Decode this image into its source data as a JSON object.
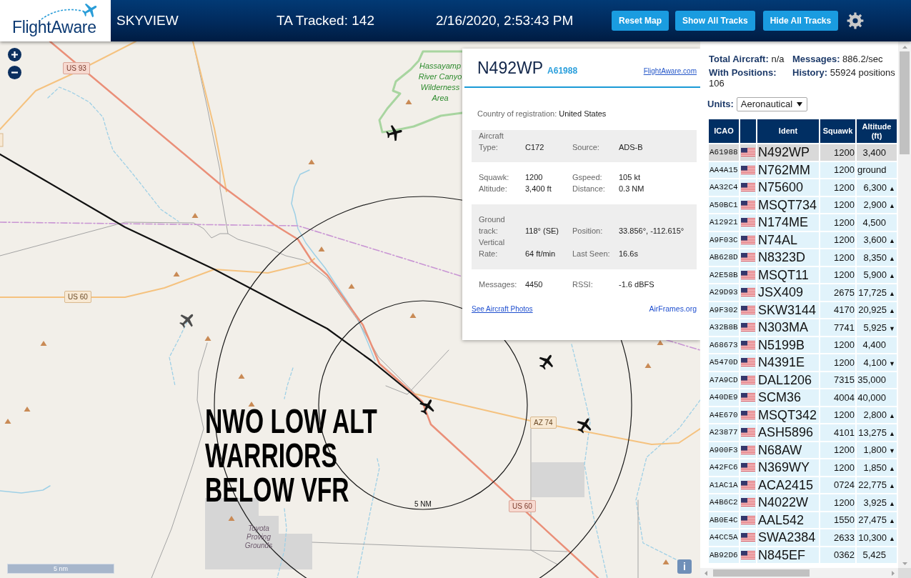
{
  "header": {
    "logo": "FlightAware",
    "app_name": "SKYVIEW",
    "tracked": "TA Tracked: 142",
    "datetime": "2/16/2020, 2:53:43 PM",
    "buttons": [
      "Reset Map",
      "Show All Tracks",
      "Hide All Tracks"
    ]
  },
  "map": {
    "labels": [
      {
        "kind": "trunk_shield",
        "text": "US 93"
      },
      {
        "kind": "area_label",
        "lines": [
          "Hassayamp",
          "River Canyo",
          "Wilderness",
          "Area"
        ]
      },
      {
        "kind": "primary_shield",
        "text": "US 60"
      },
      {
        "kind": "primary_shield",
        "text": "AZ 74"
      },
      {
        "kind": "trunk_shield",
        "text": "US 60"
      },
      {
        "kind": "ring_label",
        "text": "5 NM"
      },
      {
        "kind": "place_label",
        "lines": [
          "Toyota",
          "Proving",
          "Grounds"
        ]
      }
    ],
    "annotation": {
      "lines": [
        "NWO LOW ALT",
        "WARRIORS",
        "BELOW VFR"
      ]
    },
    "scale": "5 nm",
    "info_button": "i"
  },
  "info_panel": {
    "registration": "N492WP",
    "icao": "A61988",
    "external_link": "FlightAware.com",
    "sections": [
      {
        "kind": "inline",
        "fields": [
          {
            "label": "Country of registration:",
            "value": "United States"
          }
        ]
      },
      {
        "kind": "grid",
        "fields": [
          {
            "label": "Aircraft Type:",
            "value": "C172"
          },
          {
            "label": "Source:",
            "value": "ADS-B"
          }
        ]
      },
      {
        "kind": "grid",
        "fields": [
          {
            "label": "Squawk:",
            "value": "1200"
          },
          {
            "label": "Gspeed:",
            "value": "105 kt"
          },
          {
            "label": "Altitude:",
            "value": "3,400 ft"
          },
          {
            "label": "Distance:",
            "value": "0.3 NM"
          }
        ]
      },
      {
        "kind": "grid",
        "fields": [
          {
            "label": "Ground track:",
            "value": "118° (SE)"
          },
          {
            "label": "Position:",
            "value": "33.856°, -112.615°"
          },
          {
            "label": "Vertical Rate:",
            "value": "64 ft/min"
          },
          {
            "label": "Last Seen:",
            "value": "16.6s"
          }
        ]
      },
      {
        "kind": "grid",
        "fields": [
          {
            "label": "Messages:",
            "value": "4450"
          },
          {
            "label": "RSSI:",
            "value": "-1.6 dBFS"
          }
        ]
      }
    ],
    "footer_links": [
      "See Aircraft Photos",
      "AirFrames.org"
    ]
  },
  "sidebar": {
    "stats": [
      {
        "label": "Total Aircraft:",
        "value": "n/a"
      },
      {
        "label": "Messages:",
        "value": "886.2/sec"
      },
      {
        "label": "With Positions:",
        "value": "106"
      },
      {
        "label": "History:",
        "value": "55924 positions"
      }
    ],
    "units": {
      "label": "Units:",
      "value": "Aeronautical"
    },
    "table": {
      "columns": [
        "ICAO",
        "Ident",
        "Squawk",
        "Altitude (ft)"
      ],
      "rows": [
        {
          "icao": "A61988",
          "ident": "N492WP",
          "squawk": "1200",
          "altitude": "3,400",
          "selected": true
        },
        {
          "icao": "AA4A15",
          "ident": "N762MM",
          "squawk": "1200",
          "altitude": "ground",
          "selected": false
        },
        {
          "icao": "AA32C4",
          "ident": "N75600",
          "squawk": "1200",
          "altitude": "6,300",
          "trend": "▲",
          "selected": false
        },
        {
          "icao": "A50BC1",
          "ident": "MSQT734",
          "squawk": "1200",
          "altitude": "2,900",
          "trend": "▲",
          "selected": false
        },
        {
          "icao": "A12921",
          "ident": "N174ME",
          "squawk": "1200",
          "altitude": "4,500",
          "selected": false
        },
        {
          "icao": "A9F03C",
          "ident": "N74AL",
          "squawk": "1200",
          "altitude": "3,600",
          "trend": "▲",
          "selected": false
        },
        {
          "icao": "AB628D",
          "ident": "N8323D",
          "squawk": "1200",
          "altitude": "8,350",
          "trend": "▲",
          "selected": false
        },
        {
          "icao": "A2E58B",
          "ident": "MSQT11",
          "squawk": "1200",
          "altitude": "5,900",
          "trend": "▲",
          "selected": false
        },
        {
          "icao": "A29D93",
          "ident": "JSX409",
          "squawk": "2675",
          "altitude": "17,725",
          "trend": "▲",
          "selected": false
        },
        {
          "icao": "A9F302",
          "ident": "SKW3144",
          "squawk": "4170",
          "altitude": "20,925",
          "trend": "▲",
          "selected": false
        },
        {
          "icao": "A32B8B",
          "ident": "N303MA",
          "squawk": "7741",
          "altitude": "5,925",
          "trend": "▼",
          "selected": false
        },
        {
          "icao": "A68673",
          "ident": "N5199B",
          "squawk": "1200",
          "altitude": "4,400",
          "selected": false
        },
        {
          "icao": "A5470D",
          "ident": "N4391E",
          "squawk": "1200",
          "altitude": "4,100",
          "trend": "▼",
          "selected": false
        },
        {
          "icao": "A7A9CD",
          "ident": "DAL1206",
          "squawk": "7315",
          "altitude": "35,000",
          "selected": false
        },
        {
          "icao": "A40DE9",
          "ident": "SCM36",
          "squawk": "4004",
          "altitude": "40,000",
          "selected": false
        },
        {
          "icao": "A4E670",
          "ident": "MSQT342",
          "squawk": "1200",
          "altitude": "2,800",
          "trend": "▲",
          "selected": false
        },
        {
          "icao": "A23877",
          "ident": "ASH5896",
          "squawk": "4101",
          "altitude": "13,275",
          "trend": "▲",
          "selected": false
        },
        {
          "icao": "A900F3",
          "ident": "N68AW",
          "squawk": "1200",
          "altitude": "1,800",
          "trend": "▼",
          "selected": false
        },
        {
          "icao": "A42FC6",
          "ident": "N369WY",
          "squawk": "1200",
          "altitude": "1,850",
          "trend": "▲",
          "selected": false
        },
        {
          "icao": "A1AC1A",
          "ident": "ACA2415",
          "squawk": "0724",
          "altitude": "22,775",
          "trend": "▲",
          "selected": false
        },
        {
          "icao": "A4B6C2",
          "ident": "N4022W",
          "squawk": "1200",
          "altitude": "3,925",
          "trend": "▲",
          "selected": false
        },
        {
          "icao": "AB0E4C",
          "ident": "AAL542",
          "squawk": "1550",
          "altitude": "27,475",
          "trend": "▲",
          "selected": false
        },
        {
          "icao": "A4CC5A",
          "ident": "SWA2384",
          "squawk": "2633",
          "altitude": "10,300",
          "trend": "▲",
          "selected": false
        },
        {
          "icao": "AB92D6",
          "ident": "N845EF",
          "squawk": "0362",
          "altitude": "5,425",
          "selected": false
        }
      ]
    }
  }
}
